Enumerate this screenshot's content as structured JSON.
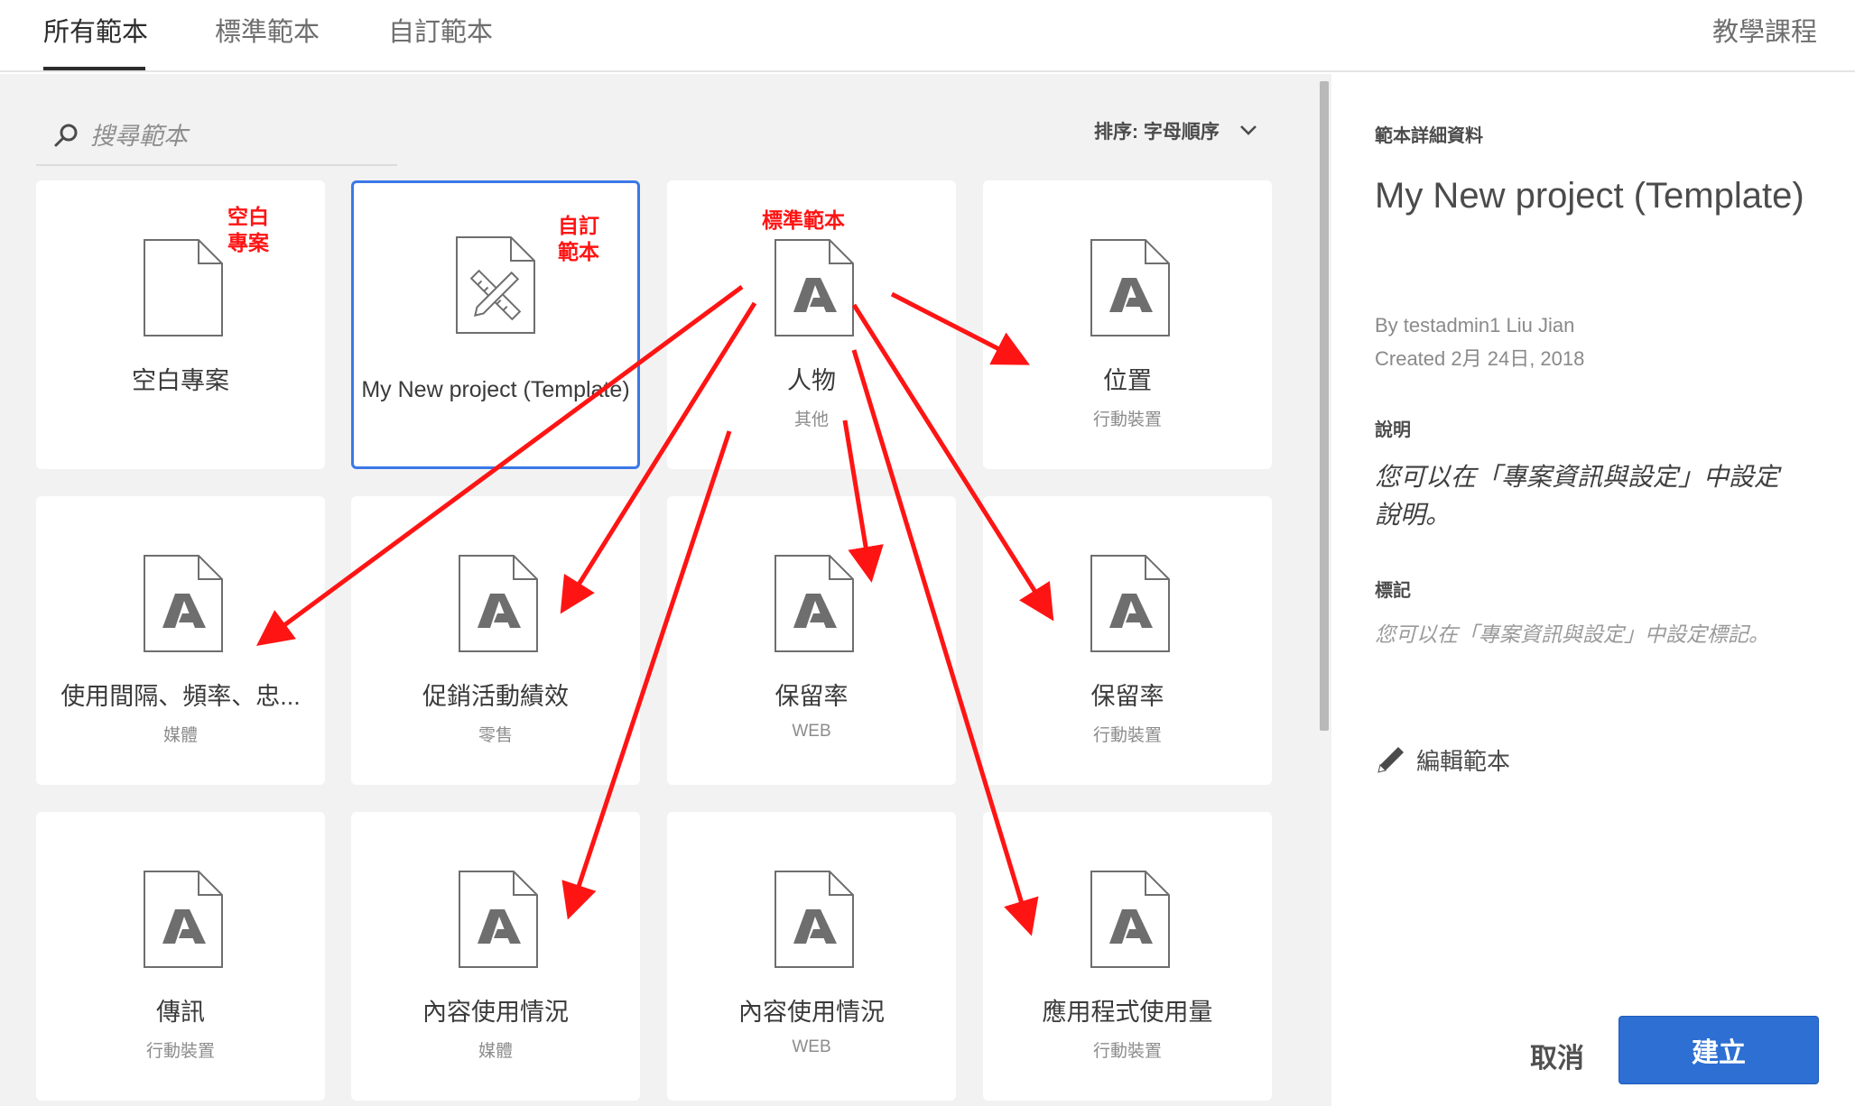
{
  "tabs": [
    {
      "label": "所有範本",
      "active": true
    },
    {
      "label": "標準範本",
      "active": false
    },
    {
      "label": "自訂範本",
      "active": false
    }
  ],
  "tutorial_label": "教學課程",
  "search": {
    "placeholder": "搜尋範本"
  },
  "sort": {
    "label": "排序: 字母順序"
  },
  "cards": [
    {
      "title": "空白專案",
      "subtitle": "",
      "icon": "blank-document-icon"
    },
    {
      "title": "My New project (Template)",
      "subtitle": "",
      "icon": "custom-template-document-icon",
      "selected": true
    },
    {
      "title": "人物",
      "subtitle": "其他",
      "icon": "adobe-document-icon"
    },
    {
      "title": "位置",
      "subtitle": "行動裝置",
      "icon": "adobe-document-icon"
    },
    {
      "title": "使用間隔、頻率、忠...",
      "subtitle": "媒體",
      "icon": "adobe-document-icon"
    },
    {
      "title": "促銷活動績效",
      "subtitle": "零售",
      "icon": "adobe-document-icon"
    },
    {
      "title": "保留率",
      "subtitle": "WEB",
      "icon": "adobe-document-icon"
    },
    {
      "title": "保留率",
      "subtitle": "行動裝置",
      "icon": "adobe-document-icon"
    },
    {
      "title": "傳訊",
      "subtitle": "行動裝置",
      "icon": "adobe-document-icon"
    },
    {
      "title": "內容使用情況",
      "subtitle": "媒體",
      "icon": "adobe-document-icon"
    },
    {
      "title": "內容使用情況",
      "subtitle": "WEB",
      "icon": "adobe-document-icon"
    },
    {
      "title": "應用程式使用量",
      "subtitle": "行動裝置",
      "icon": "adobe-document-icon"
    }
  ],
  "annotations": {
    "blank": [
      "空白",
      "專案"
    ],
    "custom": [
      "自訂",
      "範本"
    ],
    "standard": "標準範本"
  },
  "details": {
    "heading": "範本詳細資料",
    "title": "My New project (Template)",
    "by": "By testadmin1 Liu Jian",
    "created": "Created 2月 24日, 2018",
    "description_label": "說明",
    "description": "您可以在「專案資訊與設定」中設定說明。",
    "tags_label": "標記",
    "tags": "您可以在「專案資訊與設定」中設定標記。",
    "edit_label": "編輯範本"
  },
  "buttons": {
    "cancel": "取消",
    "create": "建立"
  },
  "colors": {
    "accent": "#2d6fd2",
    "annotation": "#ff1414",
    "selected_border": "#3b78e7"
  }
}
